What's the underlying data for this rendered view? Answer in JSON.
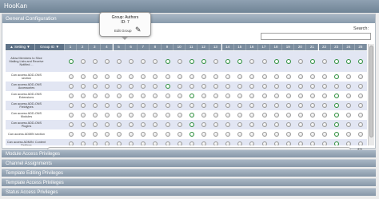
{
  "window": {
    "title": "HooKan"
  },
  "general_config": {
    "title": "General Configuration"
  },
  "search": {
    "label": "Search:",
    "value": ""
  },
  "tooltip": {
    "line1": "Group: Authors",
    "line2": "ID: 7",
    "edit_label": "Edit Group",
    "edit_icon": "pencil-icon"
  },
  "grid": {
    "setting_header": "▲ Setting ▼",
    "group_header": "Group ID ▼",
    "columns": [
      "1",
      "2",
      "3",
      "4",
      "5",
      "6",
      "7",
      "8",
      "9",
      "10",
      "11",
      "12",
      "13",
      "14",
      "15",
      "16",
      "17",
      "18",
      "19",
      "20",
      "21",
      "22",
      "23",
      "24",
      "25"
    ],
    "rows": [
      {
        "label": "Allow Members to Slice Mailing Lists and Receive Notified ...",
        "on": [
          0,
          8,
          10,
          11,
          13,
          14,
          17,
          18,
          20,
          22,
          23,
          24
        ]
      },
      {
        "label": "Can access ADD-ONS section",
        "on": [
          22
        ]
      },
      {
        "label": "Can access ADD-ONS Accessories",
        "on": [
          8
        ]
      },
      {
        "label": "Can access ADD-ONS Extensions",
        "on": [
          10,
          22
        ]
      },
      {
        "label": "Can access ADD-ONS Fieldtypes",
        "on": [
          22
        ]
      },
      {
        "label": "Can access ADD-ONS Modules",
        "on": [
          10,
          22
        ]
      },
      {
        "label": "Can access ADD-ONS Plugins",
        "on": [
          10,
          22
        ]
      },
      {
        "label": "Can access ADMIN section",
        "on": [
          10,
          22
        ]
      },
      {
        "label": "Can access ADMIN: Content Settings",
        "on": [
          22
        ]
      }
    ]
  },
  "scroll": {
    "arrows": "◂ ▸"
  },
  "sections": [
    "Module Access Privileges",
    "Channel Assignments",
    "Template Editing Privileges",
    "Template Access Privileges",
    "Status Access Privileges"
  ]
}
